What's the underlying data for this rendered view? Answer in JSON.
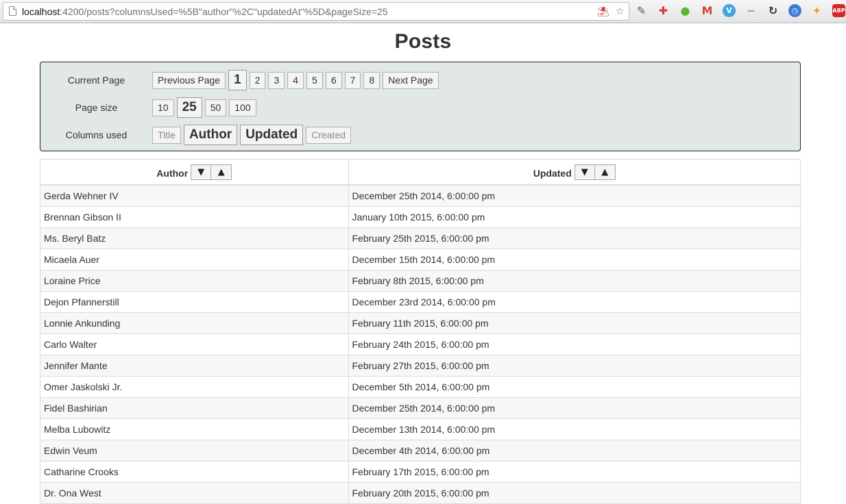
{
  "browser": {
    "url_host": "localhost",
    "url_rest": ":4200/posts?columnsUsed=%5B\"author\"%2C\"updatedAt\"%5D&pageSize=25",
    "extensions": [
      {
        "name": "color-picker",
        "glyph": "✎",
        "color": "#555555"
      },
      {
        "name": "medical-cross",
        "glyph": "✚",
        "color": "#d23b3b"
      },
      {
        "name": "evernote",
        "glyph": "●",
        "color": "#5fb33b"
      },
      {
        "name": "gmail",
        "glyph": "M",
        "color": "#d44638"
      },
      {
        "name": "vimeo",
        "glyph": "V",
        "color": "#41a5e0"
      },
      {
        "name": "minus",
        "glyph": "−",
        "color": "#9a9a9a"
      },
      {
        "name": "sync",
        "glyph": "↻",
        "color": "#333333"
      },
      {
        "name": "clock",
        "glyph": "◷",
        "color": "#3a7bd5"
      },
      {
        "name": "puzzle",
        "glyph": "✦",
        "color": "#f0a030"
      },
      {
        "name": "adblock-plus",
        "glyph": "ABP",
        "color": "#d6262b"
      }
    ]
  },
  "page": {
    "title": "Posts"
  },
  "controls": {
    "current_page": {
      "label": "Current Page",
      "prev_label": "Previous Page",
      "next_label": "Next Page",
      "pages": [
        "1",
        "2",
        "3",
        "4",
        "5",
        "6",
        "7",
        "8"
      ],
      "active": "1"
    },
    "page_size": {
      "label": "Page size",
      "options": [
        "10",
        "25",
        "50",
        "100"
      ],
      "active": "25"
    },
    "columns_used": {
      "label": "Columns used",
      "options": [
        {
          "label": "Title",
          "active": false
        },
        {
          "label": "Author",
          "active": true
        },
        {
          "label": "Updated",
          "active": true
        },
        {
          "label": "Created",
          "active": false
        }
      ]
    }
  },
  "table": {
    "columns": [
      {
        "label": "Author",
        "sort_desc": "▼",
        "sort_asc": "▲"
      },
      {
        "label": "Updated",
        "sort_desc": "▼",
        "sort_asc": "▲"
      }
    ],
    "rows": [
      {
        "author": "Gerda Wehner IV",
        "updated": "December 25th 2014, 6:00:00 pm"
      },
      {
        "author": "Brennan Gibson II",
        "updated": "January 10th 2015, 6:00:00 pm"
      },
      {
        "author": "Ms. Beryl Batz",
        "updated": "February 25th 2015, 6:00:00 pm"
      },
      {
        "author": "Micaela Auer",
        "updated": "December 15th 2014, 6:00:00 pm"
      },
      {
        "author": "Loraine Price",
        "updated": "February 8th 2015, 6:00:00 pm"
      },
      {
        "author": "Dejon Pfannerstill",
        "updated": "December 23rd 2014, 6:00:00 pm"
      },
      {
        "author": "Lonnie Ankunding",
        "updated": "February 11th 2015, 6:00:00 pm"
      },
      {
        "author": "Carlo Walter",
        "updated": "February 24th 2015, 6:00:00 pm"
      },
      {
        "author": "Jennifer Mante",
        "updated": "February 27th 2015, 6:00:00 pm"
      },
      {
        "author": "Omer Jaskolski Jr.",
        "updated": "December 5th 2014, 6:00:00 pm"
      },
      {
        "author": "Fidel Bashirian",
        "updated": "December 25th 2014, 6:00:00 pm"
      },
      {
        "author": "Melba Lubowitz",
        "updated": "December 13th 2014, 6:00:00 pm"
      },
      {
        "author": "Edwin Veum",
        "updated": "December 4th 2014, 6:00:00 pm"
      },
      {
        "author": "Catharine Crooks",
        "updated": "February 17th 2015, 6:00:00 pm"
      },
      {
        "author": "Dr. Ona West",
        "updated": "February 20th 2015, 6:00:00 pm"
      }
    ]
  }
}
